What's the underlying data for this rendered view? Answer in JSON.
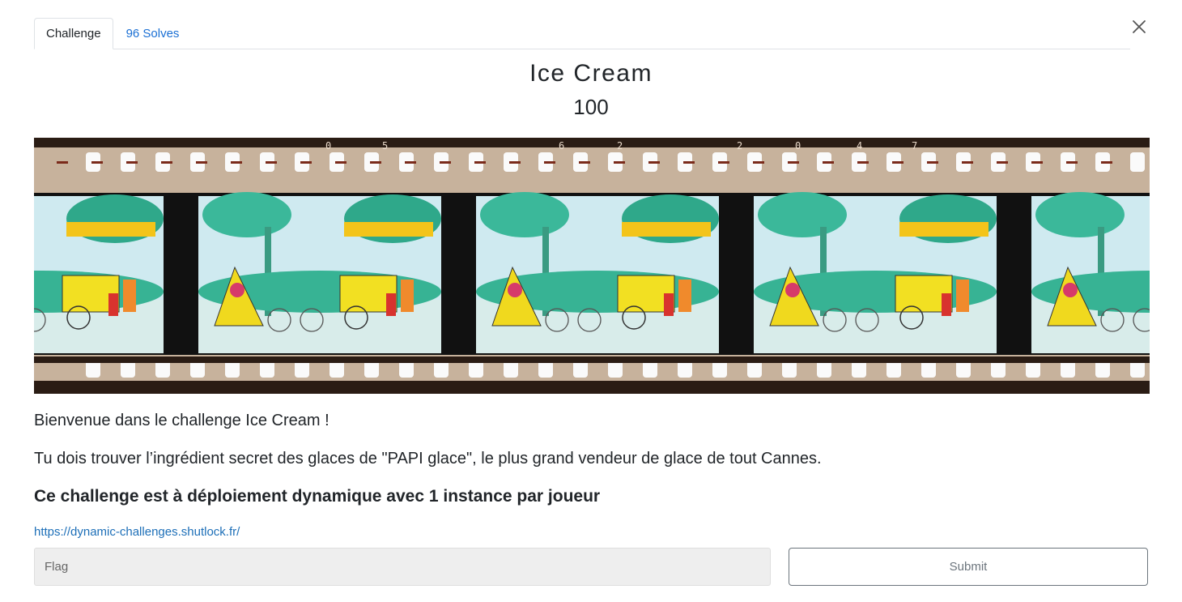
{
  "tabs": [
    {
      "label": "Challenge"
    },
    {
      "label": "96 Solves"
    }
  ],
  "challenge": {
    "name": "Ice Cream",
    "value": "100"
  },
  "film": {
    "edge_numbers": [
      "0",
      "5",
      "6",
      "2",
      "2",
      "0",
      "4",
      "7"
    ],
    "frames": 5
  },
  "description": {
    "intro": "Bienvenue dans le challenge Ice Cream !",
    "task": "Tu dois trouver l’ingrédient secret des glaces de \"PAPI glace\", le plus grand vendeur de glace de tout Cannes.",
    "deployment_note": "Ce challenge est à déploiement dynamique avec 1 instance par joueur",
    "link": "https://dynamic-challenges.shutlock.fr/"
  },
  "form": {
    "flag_placeholder": "Flag",
    "submit_label": "Submit"
  },
  "icons": {
    "close": "close-icon"
  }
}
